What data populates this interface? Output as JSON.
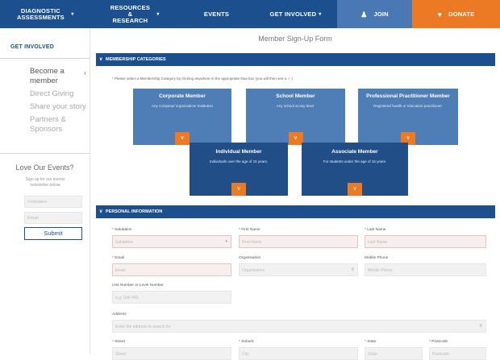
{
  "nav": {
    "items": [
      {
        "label": "DIAGNOSTIC ASSESSMENTS",
        "caret": "▾"
      },
      {
        "label": "RESOURCES & RESEARCH",
        "caret": "▾"
      },
      {
        "label": "EVENTS",
        "caret": ""
      },
      {
        "label": "GET INVOLVED",
        "caret": "▾"
      }
    ],
    "join": "JOIN",
    "donate": "DONATE"
  },
  "sidebar": {
    "heading": "GET INVOLVED",
    "links": [
      "Become a member",
      "Direct Giving",
      "Share your story",
      "Partners & Sponsors"
    ],
    "love_heading": "Love Our Events?",
    "signup_text": "Sign up for our events newsletter below",
    "firstname_placeholder": "Firstname",
    "email_placeholder": "Email",
    "submit_label": "Submit"
  },
  "main": {
    "title": "Member Sign-Up Form",
    "membership_band": "MEMBERSHIP CATEGORIES",
    "note": "* Please select a Membership Category by clicking anywhere in the appropriate blue box (you will then see a",
    "cards": [
      {
        "title": "Corporate Member",
        "desc": "Any company/ organisation/ Institution"
      },
      {
        "title": "School Member",
        "desc": "Any school at any level."
      },
      {
        "title": "Professional Practitioner Member",
        "desc": "Registered health or education practitioner."
      },
      {
        "title": "Individual Member",
        "desc": "Individuals over the age of 15 years."
      },
      {
        "title": "Associate Member",
        "desc": "For students under the age of 15 years."
      }
    ],
    "personal_band": "PERSONAL INFORMATION",
    "fields": {
      "salutation": {
        "label": "Salutation",
        "placeholder": "Salutation"
      },
      "first_name": {
        "label": "First Name",
        "placeholder": "First Name"
      },
      "last_name": {
        "label": "Last Name",
        "placeholder": "Last Name"
      },
      "email": {
        "label": "Email",
        "placeholder": "Email"
      },
      "organisation": {
        "label": "Organisation",
        "placeholder": "Organisation"
      },
      "mobile": {
        "label": "Mobile Phone",
        "placeholder": "Mobile Phone"
      },
      "unit": {
        "label": "Unit Number or Level Number",
        "placeholder": "e.g. Unit 445"
      },
      "address": {
        "label": "Address",
        "placeholder": "Enter the address to search for"
      },
      "street": {
        "label": "Street",
        "placeholder": "Street"
      },
      "suburb": {
        "label": "Suburb",
        "placeholder": "City"
      },
      "state": {
        "label": "State",
        "placeholder": "State"
      },
      "postcode": {
        "label": "Postcode",
        "placeholder": "Postcode"
      }
    }
  },
  "colors": {
    "nav": "#1c4f8e",
    "join": "#4a78b4",
    "donate": "#ec7a24",
    "card": "#4f7db6",
    "card_dark": "#224e88"
  }
}
